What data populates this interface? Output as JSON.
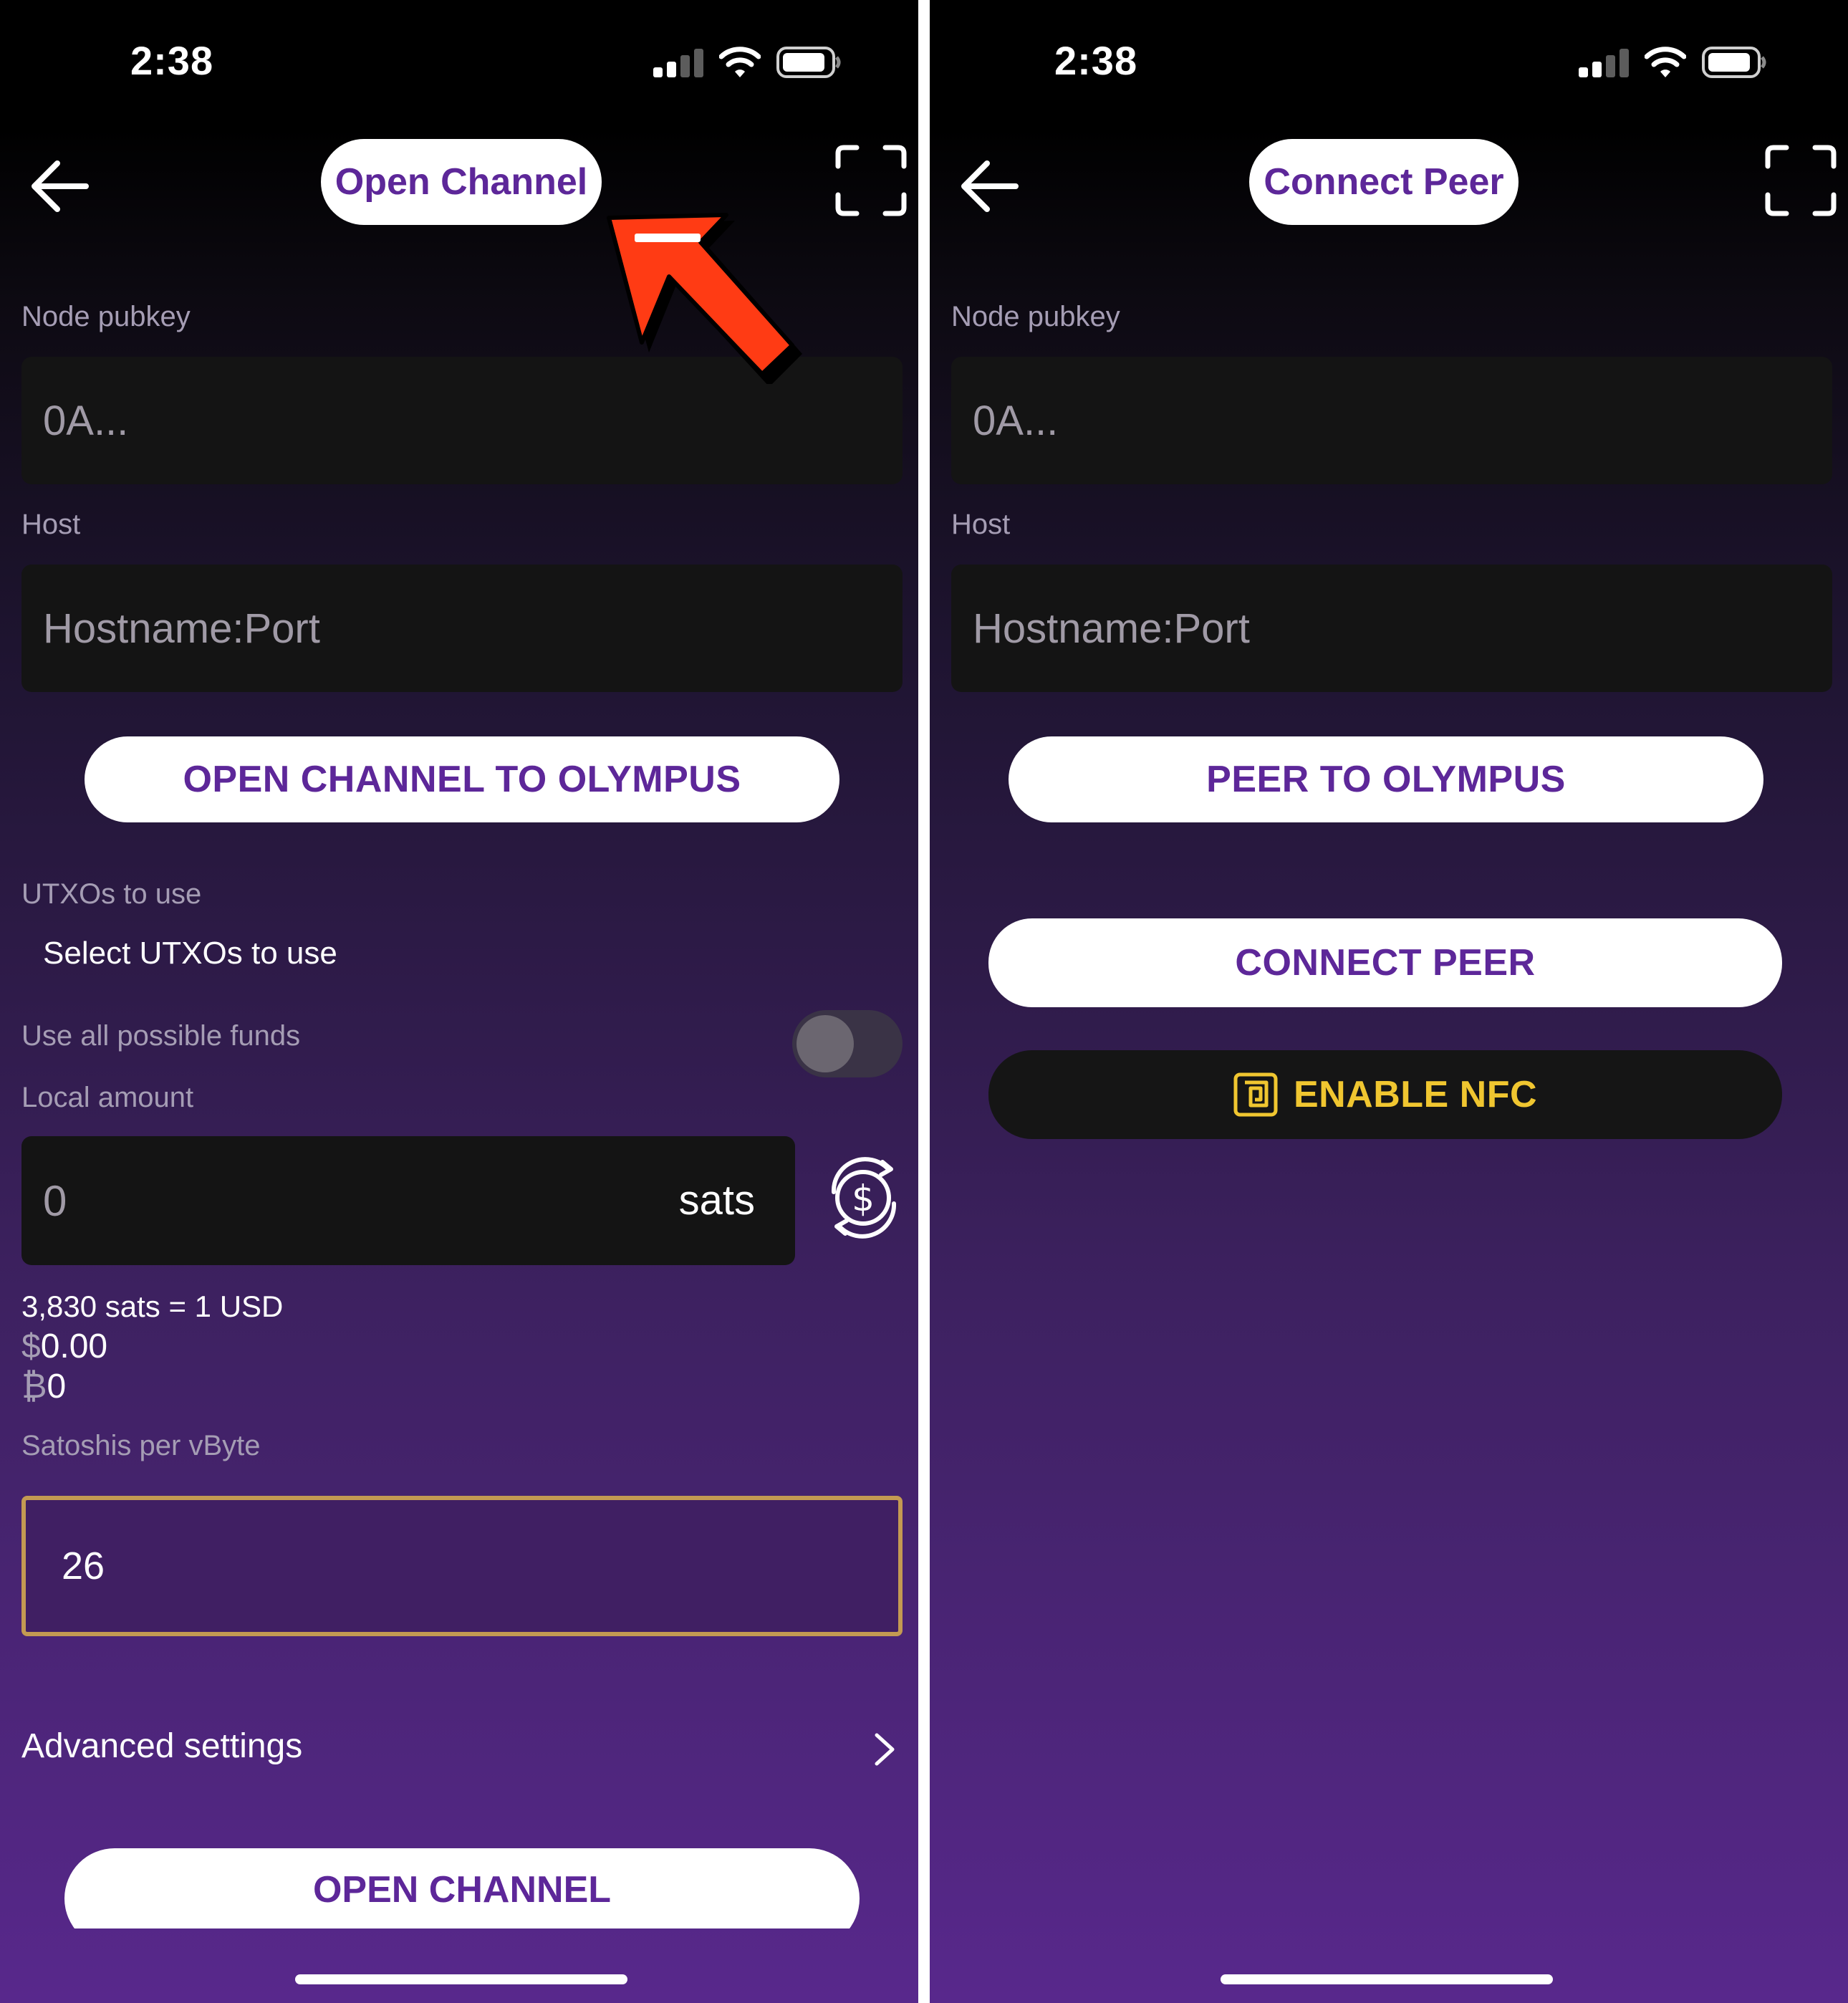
{
  "left_screen": {
    "status": {
      "time": "2:38"
    },
    "header": {
      "title": "Open Channel"
    },
    "node_pubkey": {
      "label": "Node pubkey",
      "placeholder": "0A..."
    },
    "host": {
      "label": "Host",
      "placeholder": "Hostname:Port"
    },
    "olympus_button": "OPEN CHANNEL TO OLYMPUS",
    "utxos": {
      "label": "UTXOs to use",
      "value": "Select UTXOs to use"
    },
    "use_all_funds": {
      "label": "Use all possible funds",
      "enabled": false
    },
    "local_amount": {
      "label": "Local amount",
      "value": "0",
      "unit": "sats"
    },
    "conversion": {
      "rate": "3,830 sats = 1 USD",
      "fiat_symbol": "$",
      "fiat_value": "0.00",
      "btc_symbol": "₿",
      "btc_value": "0"
    },
    "fee": {
      "label": "Satoshis per vByte",
      "value": "26"
    },
    "advanced": {
      "label": "Advanced settings"
    },
    "submit_button": "OPEN CHANNEL"
  },
  "right_screen": {
    "status": {
      "time": "2:38"
    },
    "header": {
      "title": "Connect Peer"
    },
    "node_pubkey": {
      "label": "Node pubkey",
      "placeholder": "0A..."
    },
    "host": {
      "label": "Host",
      "placeholder": "Hostname:Port"
    },
    "olympus_button": "PEER TO OLYMPUS",
    "connect_button": "CONNECT PEER",
    "nfc_button": "ENABLE NFC"
  },
  "colors": {
    "accent_purple": "#5d2799",
    "nfc_yellow": "#f0c630",
    "focus_border": "#c49a52",
    "annotation_arrow": "#ff3b14"
  },
  "icons": [
    "back-arrow-icon",
    "scan-icon",
    "currency-convert-icon",
    "chevron-right-icon",
    "nfc-icon",
    "signal-icon",
    "wifi-icon",
    "battery-icon"
  ]
}
